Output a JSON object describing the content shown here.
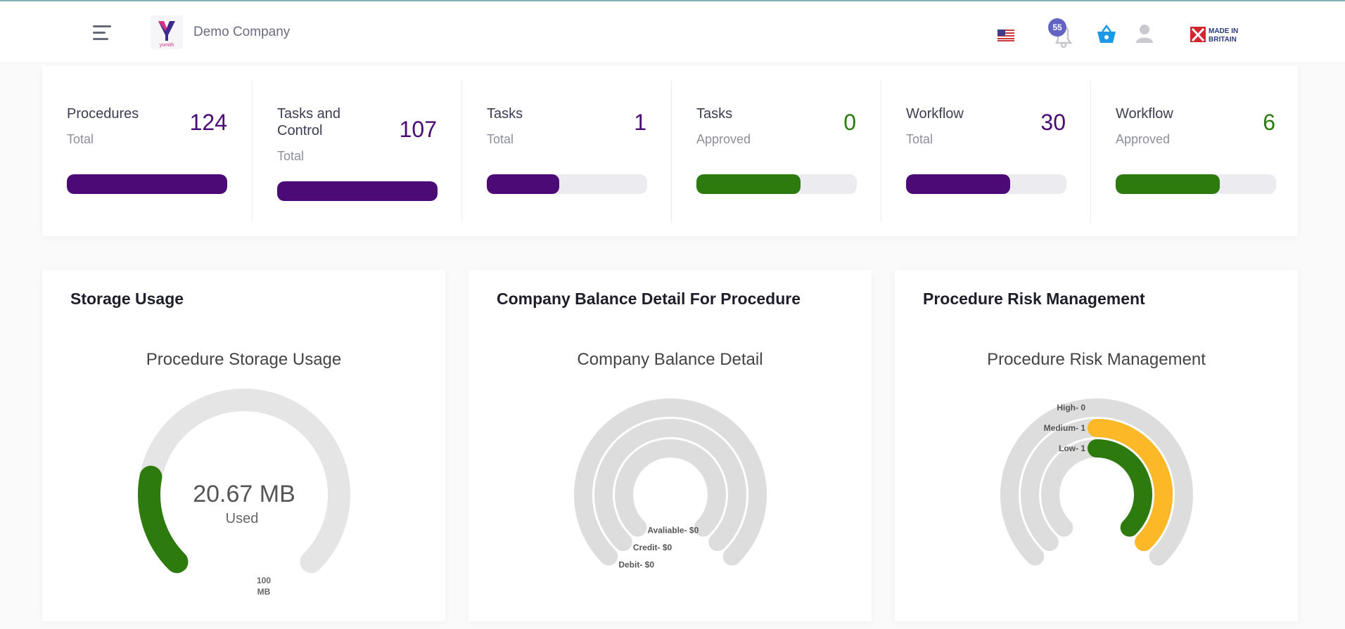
{
  "header": {
    "company_name": "Demo Company",
    "logo_text": "yomith",
    "notification_count": "55",
    "made_in_line1": "MADE IN",
    "made_in_line2": "BRITAIN"
  },
  "stats": [
    {
      "title": "Procedures",
      "subtitle": "Total",
      "value": "124",
      "fill": 1.0,
      "color": "#4b0a75"
    },
    {
      "title": "Tasks and Control",
      "subtitle": "Total",
      "value": "107",
      "fill": 1.0,
      "color": "#4b0a75"
    },
    {
      "title": "Tasks",
      "subtitle": "Total",
      "value": "1",
      "fill": 0.45,
      "color": "#4b0a75"
    },
    {
      "title": "Tasks",
      "subtitle": "Approved",
      "value": "0",
      "fill": 0.65,
      "color": "#2d7a0e"
    },
    {
      "title": "Workflow",
      "subtitle": "Total",
      "value": "30",
      "fill": 0.65,
      "color": "#4b0a75"
    },
    {
      "title": "Workflow",
      "subtitle": "Approved",
      "value": "6",
      "fill": 0.65,
      "color": "#2d7a0e"
    }
  ],
  "cards": {
    "storage": {
      "title": "Storage Usage",
      "chart_title": "Procedure Storage Usage",
      "value_text": "20.67 MB",
      "value_caption": "Used",
      "max_label_1": "100",
      "max_label_2": "MB"
    },
    "balance": {
      "title": "Company Balance Detail For Procedure",
      "chart_title": "Company Balance Detail"
    },
    "risk": {
      "title": "Procedure Risk Management",
      "chart_title": "Procedure Risk Management"
    }
  },
  "chart_data": [
    {
      "type": "radialBar",
      "title": "Procedure Storage Usage",
      "series": [
        {
          "name": "Used",
          "value": 20.67,
          "max": 100,
          "color": "#2d7a0e"
        }
      ],
      "center_text": "20.67 MB",
      "center_caption": "Used",
      "max_label": "100 MB"
    },
    {
      "type": "radialBar",
      "title": "Company Balance Detail",
      "series": [
        {
          "name": "Avaliable",
          "label": "Avaliable- $0",
          "value": 0
        },
        {
          "name": "Credit",
          "label": "Credit- $0",
          "value": 0
        },
        {
          "name": "Debit",
          "label": "Debit- $0",
          "value": 0
        }
      ]
    },
    {
      "type": "radialBar",
      "title": "Procedure Risk Management",
      "series": [
        {
          "name": "High",
          "label": "High- 0",
          "value": 0,
          "color": "#dddddd"
        },
        {
          "name": "Medium",
          "label": "Medium- 1",
          "value": 1,
          "color": "#fdb827"
        },
        {
          "name": "Low",
          "label": "Low- 1",
          "value": 1,
          "color": "#2d7a0e"
        }
      ]
    }
  ]
}
